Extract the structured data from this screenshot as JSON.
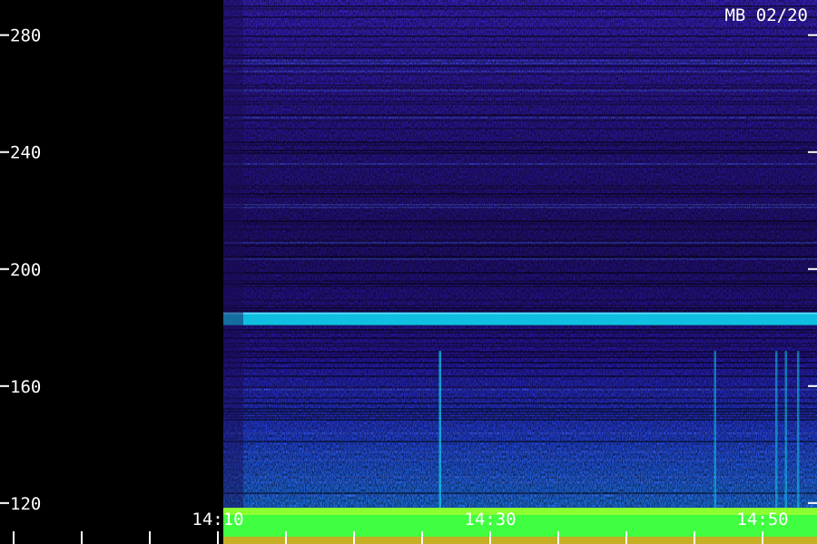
{
  "chart_data": {
    "type": "heatmap",
    "title": "MB 02/20",
    "y_ticks": [
      120,
      160,
      200,
      240,
      280
    ],
    "y_tick_labels": [
      "120",
      "160",
      "200",
      "240",
      "280"
    ],
    "x_ticks": [
      "14:10",
      "14:30",
      "14:50"
    ],
    "x_tick_minutes": [
      10,
      30,
      50
    ],
    "x_range_minutes": [
      -6,
      54
    ],
    "y_range": [
      106,
      292
    ],
    "data_start_minute": 10.4,
    "bright_bands": [
      {
        "frequency": 183,
        "intensity": 0.58
      },
      {
        "frequency": 102,
        "intensity": 0.85
      }
    ],
    "transient_lines_minutes": [
      26.3,
      46.5,
      51.0,
      51.7,
      52.6
    ],
    "grid": false
  },
  "colors": {
    "background": "#000000",
    "low": "#1a0a3c",
    "mid": "#3a20d8",
    "high": "#10c8e8",
    "peak": "#40ff40",
    "text": "#ffffff"
  }
}
